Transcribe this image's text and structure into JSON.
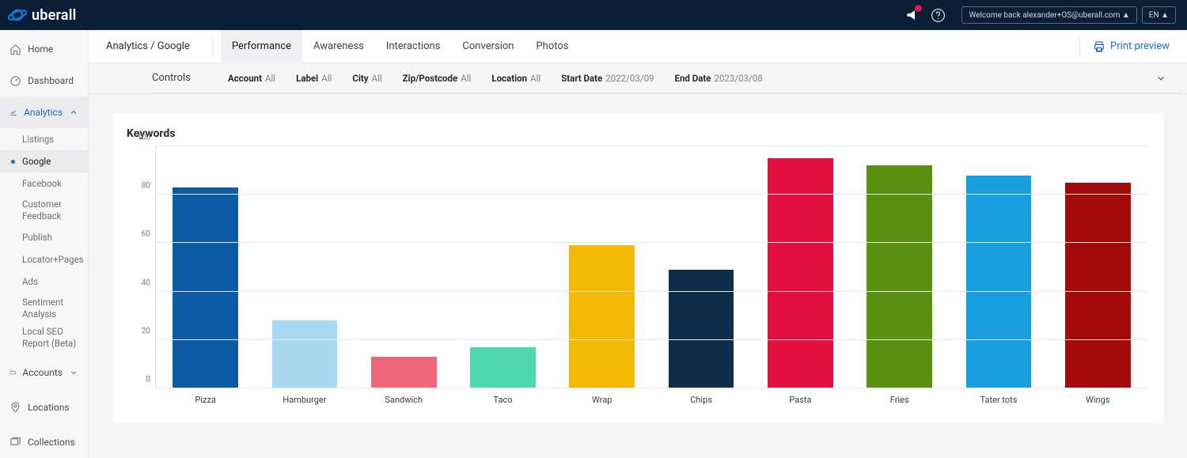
{
  "header": {
    "brand": "uberall",
    "welcome": "Welcome back  alexander+OS@uberall.com ▲",
    "lang": "EN ▲"
  },
  "sidebar": {
    "home": "Home",
    "dashboard": "Dashboard",
    "analytics": "Analytics",
    "subitems": {
      "listings": "Listings",
      "google": "Google",
      "facebook": "Facebook",
      "customer_feedback": "Customer Feedback",
      "publish": "Publish",
      "locator_pages": "Locator+Pages",
      "ads": "Ads",
      "sentiment": "Sentiment Analysis",
      "local_seo": "Local SEO Report (Beta)"
    },
    "accounts": "Accounts",
    "locations": "Locations",
    "collections": "Collections"
  },
  "crumb": "Analytics / Google",
  "tabs": {
    "performance": "Performance",
    "awareness": "Awareness",
    "interactions": "Interactions",
    "conversion": "Conversion",
    "photos": "Photos"
  },
  "print_preview": "Print preview",
  "controls": {
    "title": "Controls",
    "account": {
      "label": "Account",
      "value": "All"
    },
    "label": {
      "label": "Label",
      "value": "All"
    },
    "city": {
      "label": "City",
      "value": "All"
    },
    "zip": {
      "label": "Zip/Postcode",
      "value": "All"
    },
    "location": {
      "label": "Location",
      "value": "All"
    },
    "start": {
      "label": "Start Date",
      "value": "2022/03/09"
    },
    "end": {
      "label": "End Date",
      "value": "2023/03/08"
    }
  },
  "card": {
    "title": "Keywords"
  },
  "chart_data": {
    "type": "bar",
    "title": "Keywords",
    "xlabel": "",
    "ylabel": "",
    "ylim": [
      0,
      100
    ],
    "yticks": [
      0,
      20,
      40,
      60,
      80,
      100
    ],
    "categories": [
      "Pizza",
      "Hamburger",
      "Sandwich",
      "Taco",
      "Wrap",
      "Chips",
      "Pasta",
      "Fries",
      "Tater tots",
      "Wings"
    ],
    "values": [
      83,
      28,
      13,
      17,
      59,
      49,
      95,
      92,
      88,
      85
    ],
    "colors": [
      "#0d5aa5",
      "#a7daf0",
      "#f0677b",
      "#50d9af",
      "#f2b900",
      "#0d2d4a",
      "#e3103f",
      "#5b8f0f",
      "#179fe0",
      "#a40a0a"
    ]
  }
}
